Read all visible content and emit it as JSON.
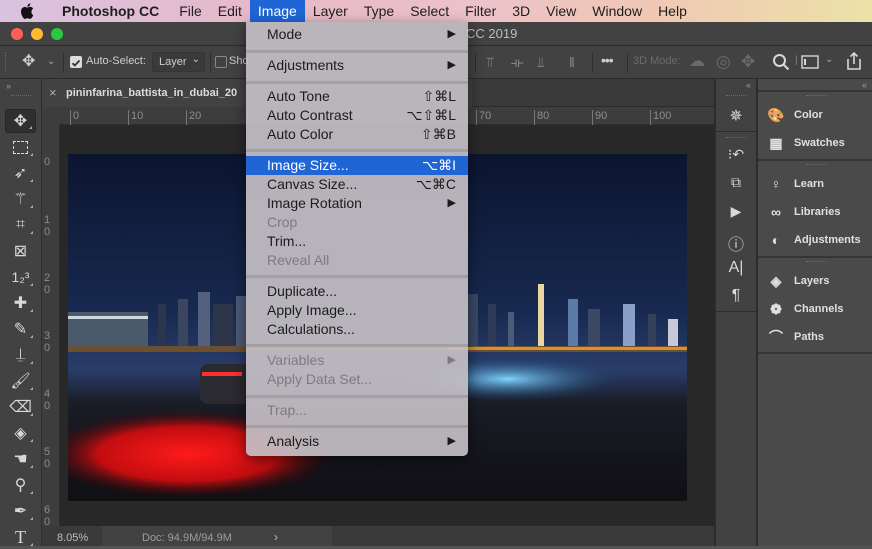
{
  "menubar": {
    "app_name": "Photoshop CC",
    "items": [
      "File",
      "Edit",
      "Image",
      "Layer",
      "Type",
      "Select",
      "Filter",
      "3D",
      "View",
      "Window",
      "Help"
    ],
    "active": "Image"
  },
  "window": {
    "title_fragment": "CC 2019"
  },
  "options_bar": {
    "auto_select_label": "Auto-Select:",
    "auto_select_checked": true,
    "auto_select_target": "Layer",
    "show_transform_fragment": "Sho",
    "three_d_mode_label": "3D Mode:"
  },
  "document": {
    "tab_name": "pininfarina_battista_in_dubai_20",
    "zoom": "8.05%",
    "doc_size": "Doc: 94.9M/94.9M"
  },
  "rulers": {
    "horizontal": [
      "0",
      "10",
      "20",
      "70",
      "80",
      "90",
      "100"
    ],
    "vertical": [
      "0",
      "10",
      "20",
      "30",
      "40",
      "50",
      "60"
    ]
  },
  "image_menu": {
    "groups": [
      [
        {
          "label": "Mode",
          "submenu": true
        }
      ],
      [
        {
          "label": "Adjustments",
          "submenu": true
        }
      ],
      [
        {
          "label": "Auto Tone",
          "shortcut": "⇧⌘L"
        },
        {
          "label": "Auto Contrast",
          "shortcut": "⌥⇧⌘L"
        },
        {
          "label": "Auto Color",
          "shortcut": "⇧⌘B"
        }
      ],
      [
        {
          "label": "Image Size...",
          "shortcut": "⌥⌘I",
          "highlighted": true
        },
        {
          "label": "Canvas Size...",
          "shortcut": "⌥⌘C"
        },
        {
          "label": "Image Rotation",
          "submenu": true
        },
        {
          "label": "Crop",
          "disabled": true
        },
        {
          "label": "Trim..."
        },
        {
          "label": "Reveal All",
          "disabled": true
        }
      ],
      [
        {
          "label": "Duplicate..."
        },
        {
          "label": "Apply Image..."
        },
        {
          "label": "Calculations..."
        }
      ],
      [
        {
          "label": "Variables",
          "submenu": true,
          "disabled": true
        },
        {
          "label": "Apply Data Set...",
          "disabled": true
        }
      ],
      [
        {
          "label": "Trap...",
          "disabled": true
        }
      ],
      [
        {
          "label": "Analysis",
          "submenu": true
        }
      ]
    ]
  },
  "toolbar": {
    "tools": [
      "move-tool",
      "marquee-tool",
      "lasso-tool",
      "magic-wand-tool",
      "crop-tool",
      "frame-tool",
      "count-tool",
      "healing-brush-tool",
      "pencil-tool",
      "clone-stamp-tool",
      "history-brush-tool",
      "eraser-tool",
      "paint-bucket-tool",
      "smudge-tool",
      "dodge-tool",
      "pen-tool",
      "type-tool"
    ],
    "selected": "move-tool"
  },
  "right_strip": {
    "icons": [
      "navigator-icon",
      "history-icon",
      "properties-icon",
      "actions-icon",
      "info-icon",
      "character-icon",
      "paragraph-icon"
    ]
  },
  "panels": {
    "groups": [
      [
        {
          "label": "Color",
          "icon": "color-palette-icon"
        },
        {
          "label": "Swatches",
          "icon": "swatches-grid-icon"
        }
      ],
      [
        {
          "label": "Learn",
          "icon": "lightbulb-icon"
        },
        {
          "label": "Libraries",
          "icon": "creative-cloud-icon"
        },
        {
          "label": "Adjustments",
          "icon": "adjustments-icon"
        }
      ],
      [
        {
          "label": "Layers",
          "icon": "layers-icon"
        },
        {
          "label": "Channels",
          "icon": "channels-icon"
        },
        {
          "label": "Paths",
          "icon": "paths-icon"
        }
      ]
    ]
  }
}
